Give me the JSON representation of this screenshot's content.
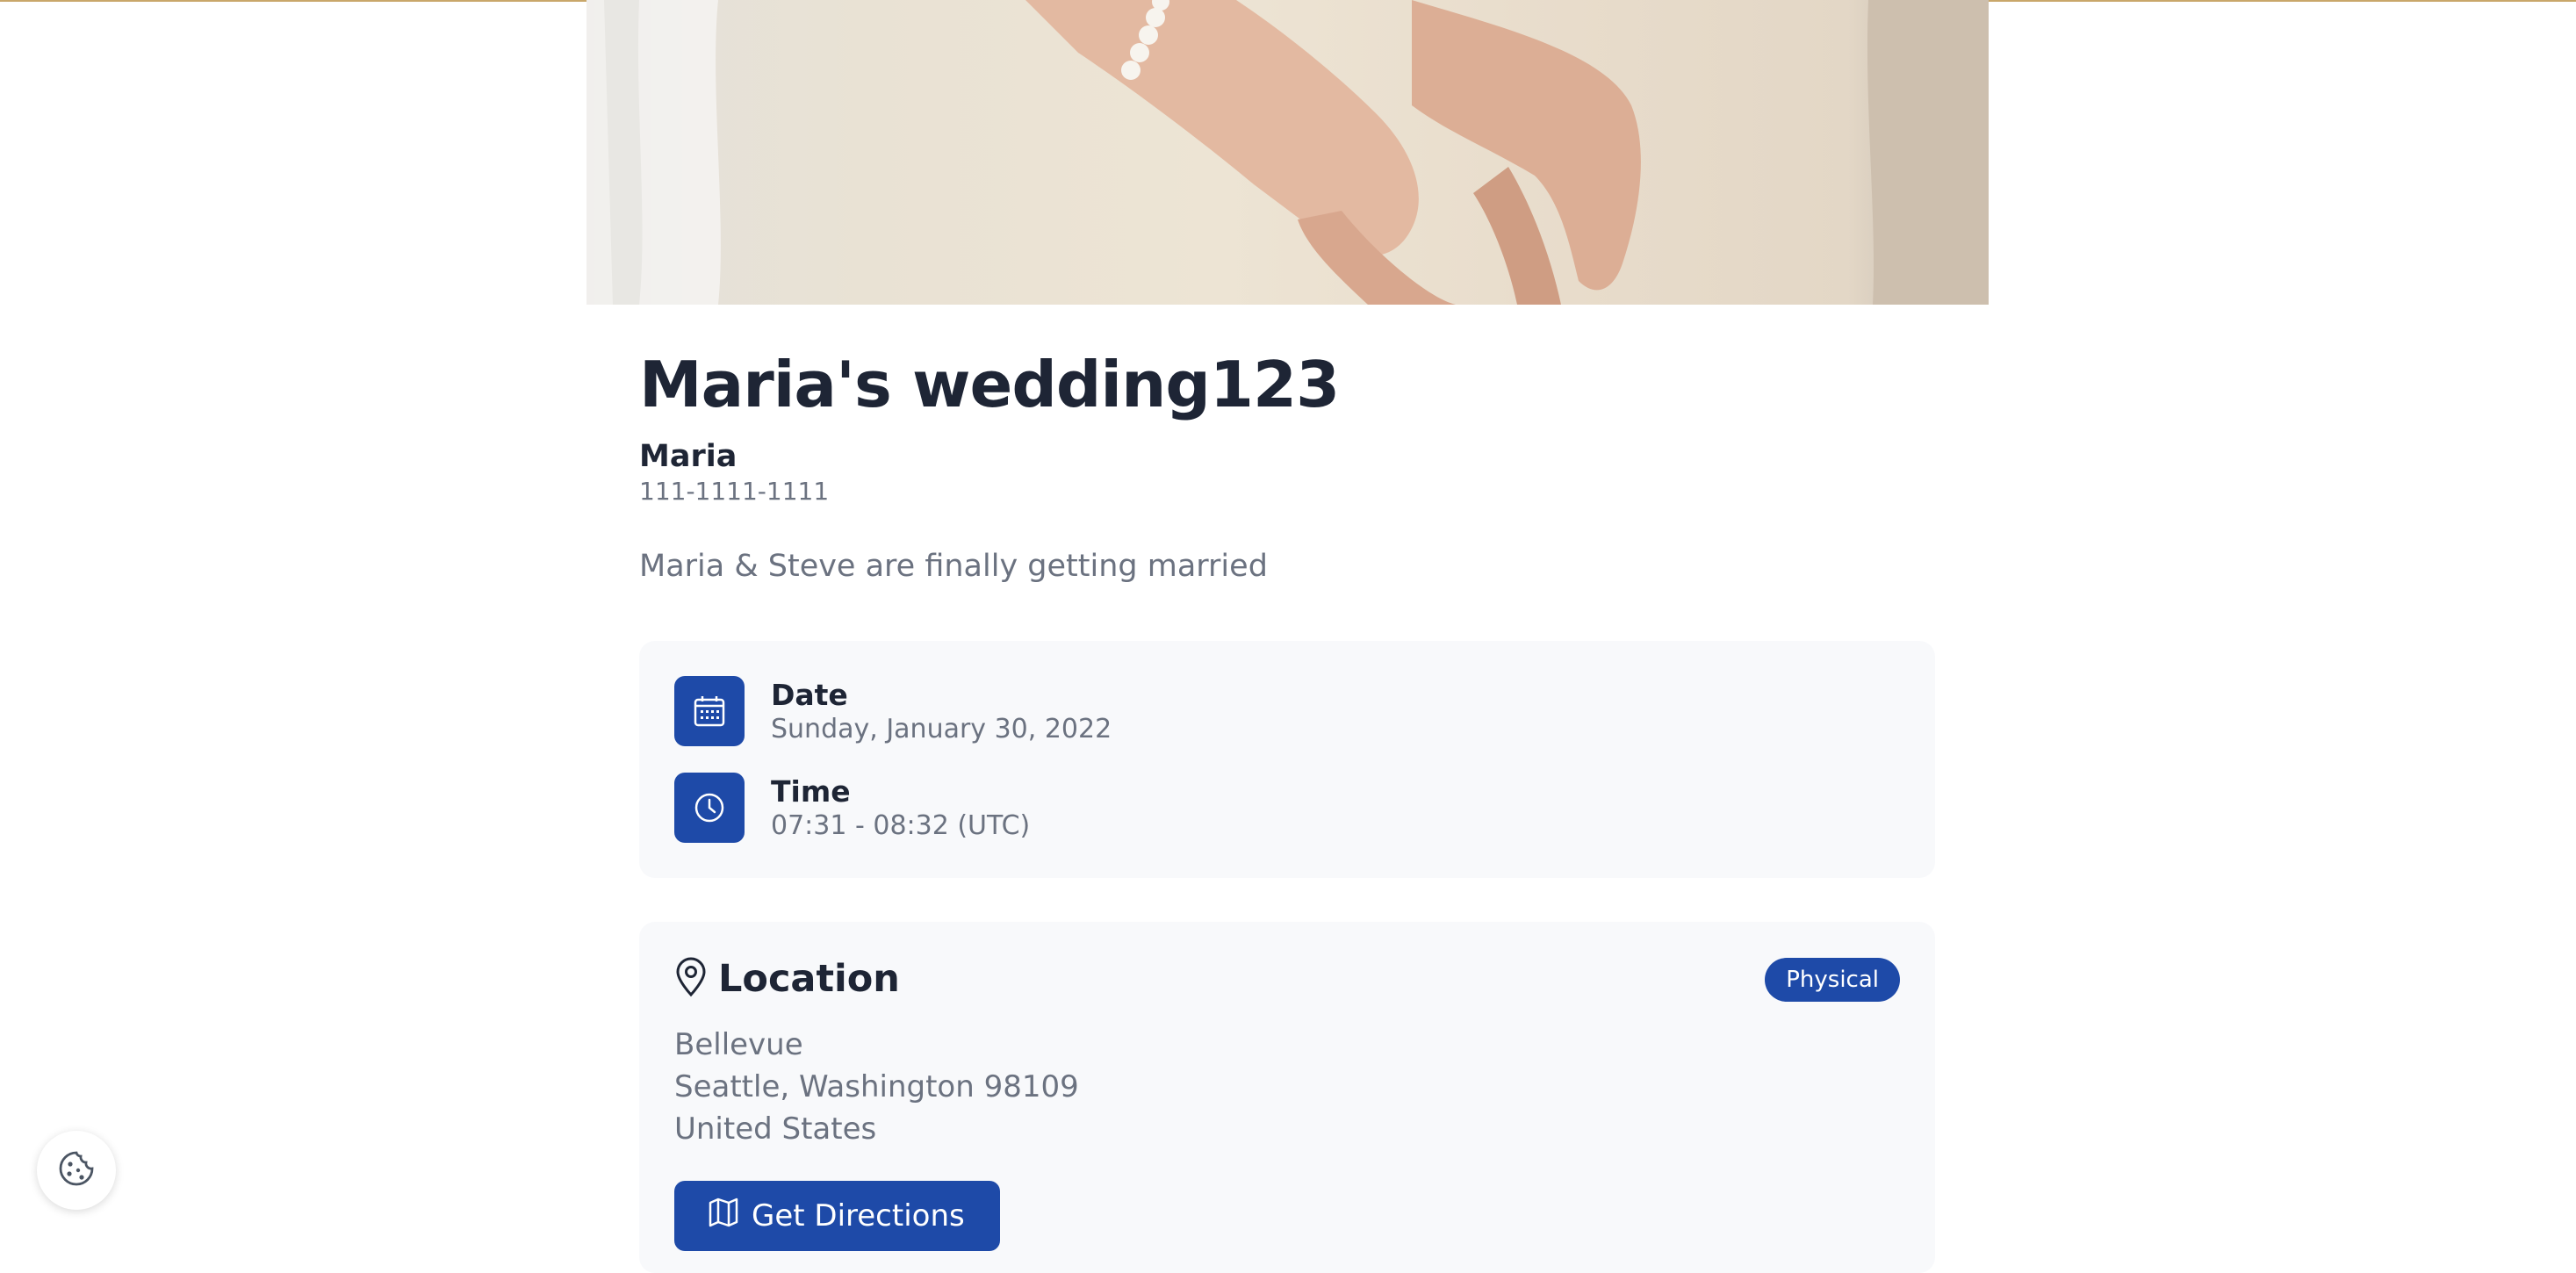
{
  "event": {
    "title": "Maria's wedding123",
    "host_name": "Maria",
    "host_phone": "111-1111-1111",
    "description": "Maria & Steve are finally getting married"
  },
  "schedule": {
    "date_label": "Date",
    "date_value": "Sunday, January 30, 2022",
    "time_label": "Time",
    "time_value": "07:31 - 08:32 (UTC)"
  },
  "location": {
    "title": "Location",
    "badge": "Physical",
    "address_lines": [
      "Bellevue",
      "Seattle, Washington 98109",
      "United States"
    ],
    "directions_label": "Get Directions"
  },
  "icons": {
    "date": "calendar-icon",
    "time": "clock-icon",
    "location": "map-pin-icon",
    "directions": "map-icon",
    "cookie": "cookie-icon"
  },
  "colors": {
    "accent": "#1e4aa8",
    "card_bg": "#f8f9fb",
    "title": "#1e2535",
    "muted": "#6b7280"
  }
}
